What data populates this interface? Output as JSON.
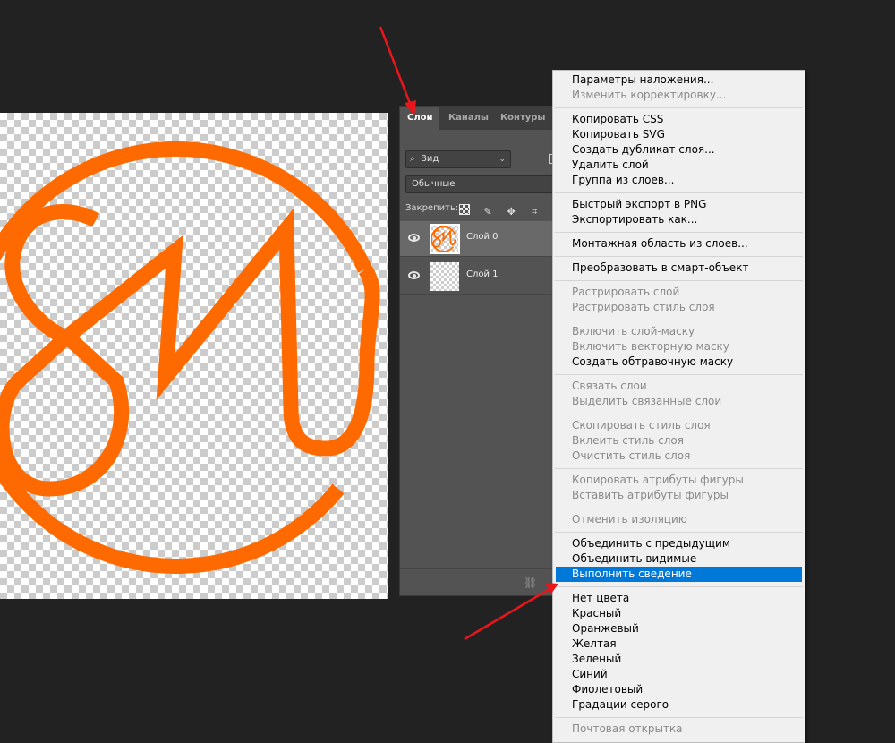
{
  "panel": {
    "tabs": [
      {
        "label": "Слои",
        "active": true
      },
      {
        "label": "Каналы",
        "active": false
      },
      {
        "label": "Контуры",
        "active": false
      }
    ],
    "filter_label": "Вид",
    "blend_mode": "Обычные",
    "lock_label": "Закрепить:",
    "layers": [
      {
        "name": "Слой 0",
        "selected": true,
        "visible": true
      },
      {
        "name": "Слой 1",
        "selected": false,
        "visible": true
      }
    ]
  },
  "menu": {
    "items": [
      {
        "label": "Параметры наложения...",
        "enabled": true
      },
      {
        "label": "Изменить корректировку...",
        "enabled": false
      },
      {
        "separator": true
      },
      {
        "label": "Копировать CSS",
        "enabled": true
      },
      {
        "label": "Копировать SVG",
        "enabled": true
      },
      {
        "label": "Создать дубликат слоя...",
        "enabled": true
      },
      {
        "label": "Удалить слой",
        "enabled": true
      },
      {
        "label": "Группа из слоев...",
        "enabled": true
      },
      {
        "separator": true
      },
      {
        "label": "Быстрый экспорт в PNG",
        "enabled": true
      },
      {
        "label": "Экспортировать как...",
        "enabled": true
      },
      {
        "separator": true
      },
      {
        "label": "Монтажная область из слоев...",
        "enabled": true
      },
      {
        "separator": true
      },
      {
        "label": "Преобразовать в смарт-объект",
        "enabled": true
      },
      {
        "separator": true
      },
      {
        "label": "Растрировать слой",
        "enabled": false
      },
      {
        "label": "Растрировать стиль слоя",
        "enabled": false
      },
      {
        "separator": true
      },
      {
        "label": "Включить слой-маску",
        "enabled": false
      },
      {
        "label": "Включить векторную маску",
        "enabled": false
      },
      {
        "label": "Создать обтравочную маску",
        "enabled": true
      },
      {
        "separator": true
      },
      {
        "label": "Связать слои",
        "enabled": false
      },
      {
        "label": "Выделить связанные слои",
        "enabled": false
      },
      {
        "separator": true
      },
      {
        "label": "Скопировать стиль слоя",
        "enabled": false
      },
      {
        "label": "Вклеить стиль слоя",
        "enabled": false
      },
      {
        "label": "Очистить стиль слоя",
        "enabled": false
      },
      {
        "separator": true
      },
      {
        "label": "Копировать атрибуты фигуры",
        "enabled": false
      },
      {
        "label": "Вставить атрибуты фигуры",
        "enabled": false
      },
      {
        "separator": true
      },
      {
        "label": "Отменить изоляцию",
        "enabled": false
      },
      {
        "separator": true
      },
      {
        "label": "Объединить с предыдущим",
        "enabled": true
      },
      {
        "label": "Объединить видимые",
        "enabled": true
      },
      {
        "label": "Выполнить сведение",
        "enabled": true,
        "highlighted": true
      },
      {
        "separator": true
      },
      {
        "label": "Нет цвета",
        "enabled": true
      },
      {
        "label": "Красный",
        "enabled": true
      },
      {
        "label": "Оранжевый",
        "enabled": true
      },
      {
        "label": "Желтая",
        "enabled": true
      },
      {
        "label": "Зеленый",
        "enabled": true
      },
      {
        "label": "Синий",
        "enabled": true
      },
      {
        "label": "Фиолетовый",
        "enabled": true
      },
      {
        "label": "Градации серого",
        "enabled": true
      },
      {
        "separator": true
      },
      {
        "label": "Почтовая открытка",
        "enabled": false
      }
    ]
  },
  "colors": {
    "logo_orange": "#ff6a00",
    "highlight": "#0078d7",
    "arrow_red": "#e8151b"
  }
}
